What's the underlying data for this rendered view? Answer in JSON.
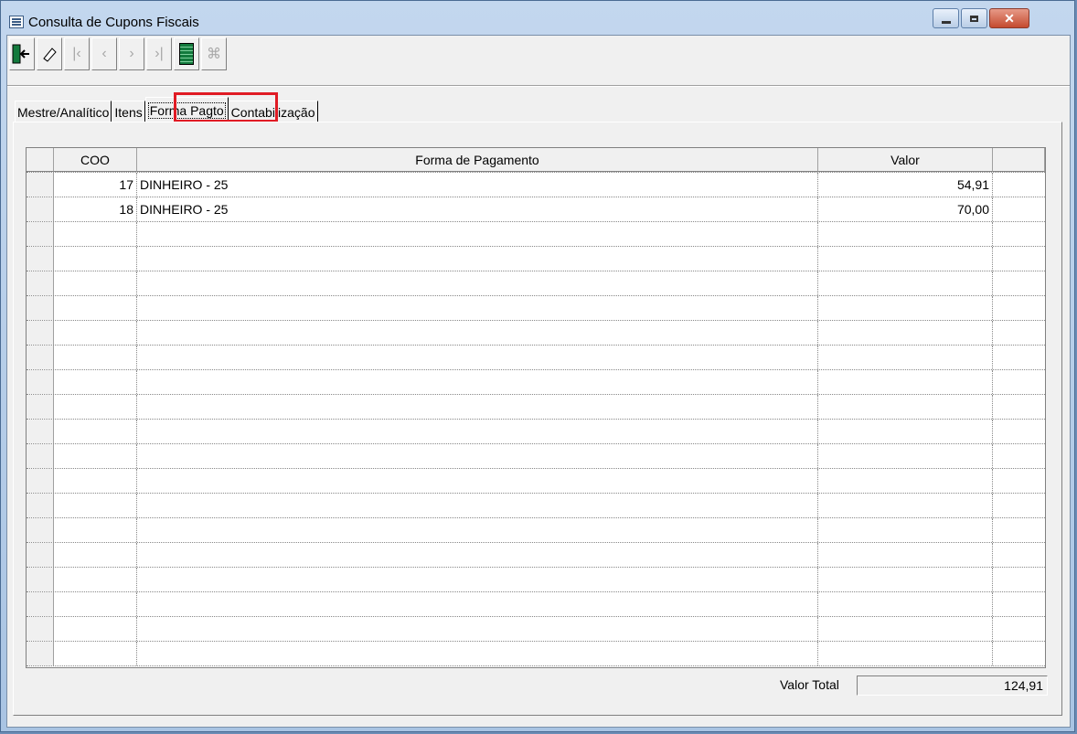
{
  "window": {
    "title": "Consulta de Cupons Fiscais",
    "controls": [
      "minimize",
      "maximize",
      "close"
    ]
  },
  "toolbar": [
    {
      "name": "exit-button",
      "icon": "exit-door-icon",
      "enabled": true
    },
    {
      "name": "eraser-button",
      "icon": "eraser-icon",
      "enabled": true
    },
    {
      "name": "first-record-button",
      "icon": "first-record-icon",
      "enabled": false
    },
    {
      "name": "previous-record-button",
      "icon": "previous-record-icon",
      "enabled": false
    },
    {
      "name": "next-record-button",
      "icon": "next-record-icon",
      "enabled": false
    },
    {
      "name": "last-record-button",
      "icon": "last-record-icon",
      "enabled": false
    },
    {
      "name": "grid-view-button",
      "icon": "grid-icon",
      "enabled": true
    },
    {
      "name": "chart-button",
      "icon": "chart-icon",
      "enabled": false
    }
  ],
  "tabs": [
    {
      "label": "Mestre/Analítico"
    },
    {
      "label": "Itens"
    },
    {
      "label": "Forma Pagto",
      "active": true
    },
    {
      "label": "Contabilização"
    }
  ],
  "grid": {
    "columns": [
      "COO",
      "Forma de Pagamento",
      "Valor"
    ],
    "rows": [
      {
        "coo": "17",
        "forma": "DINHEIRO - 25",
        "valor": "54,91"
      },
      {
        "coo": "18",
        "forma": "DINHEIRO - 25",
        "valor": "70,00"
      }
    ]
  },
  "total": {
    "label": "Valor Total",
    "value": "124,91"
  },
  "colors": {
    "highlight": "#e01b24",
    "close_button": "#c44a2f"
  }
}
